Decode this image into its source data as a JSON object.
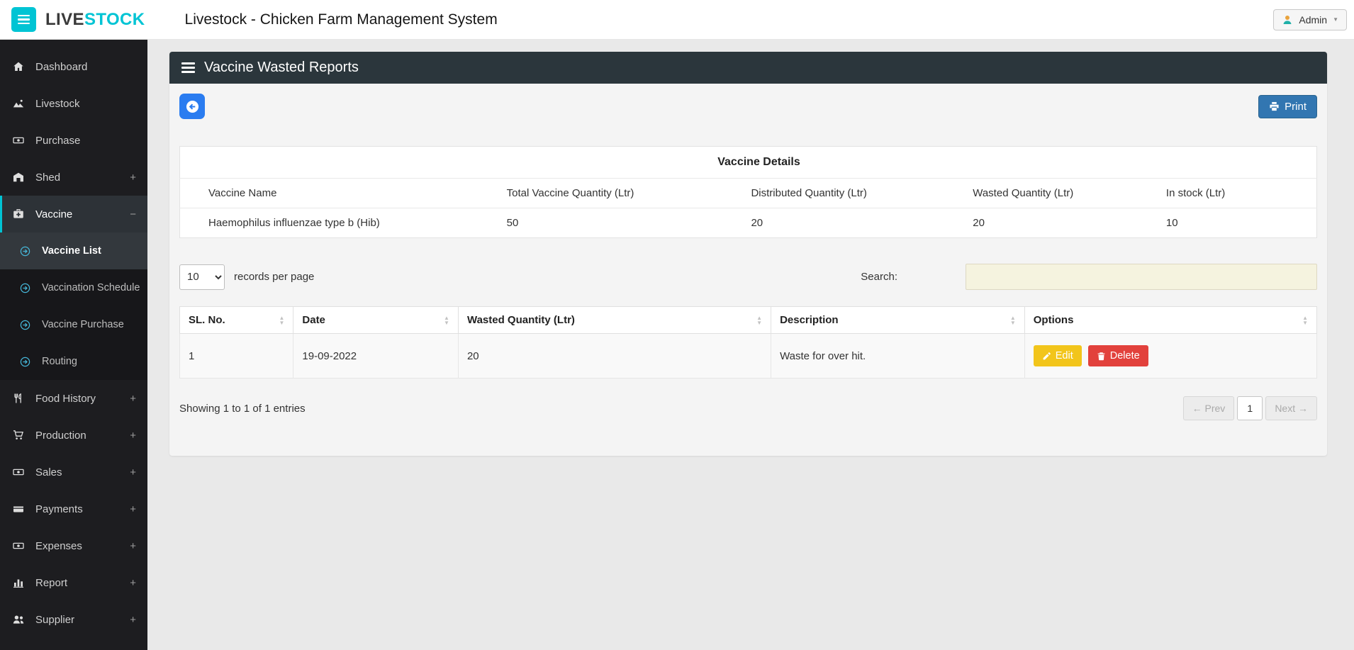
{
  "colors": {
    "accent_cyan": "#00c4d4",
    "sidebar_bg": "#1d1d20",
    "panel_header_bg": "#2b363c",
    "print_blue": "#3276b1",
    "back_blue": "#2a7cf0",
    "edit_yellow": "#f2c51b",
    "delete_red": "#e2413c",
    "search_bg": "#f5f3df"
  },
  "icons": {
    "sort_asc": "▲",
    "sort_desc": "▼",
    "caret_down": "▼"
  },
  "header": {
    "brand_live": "LIVE",
    "brand_stock": "STOCK",
    "title": "Livestock - Chicken Farm Management System",
    "admin_label": "Admin"
  },
  "sidebar": {
    "items": [
      {
        "label": "Dashboard",
        "suffix": ""
      },
      {
        "label": "Livestock",
        "suffix": ""
      },
      {
        "label": "Purchase",
        "suffix": ""
      },
      {
        "label": "Shed",
        "suffix": "+"
      },
      {
        "label": "Vaccine",
        "suffix": "−"
      },
      {
        "label": "Food History",
        "suffix": "+"
      },
      {
        "label": "Production",
        "suffix": "+"
      },
      {
        "label": "Sales",
        "suffix": "+"
      },
      {
        "label": "Payments",
        "suffix": "+"
      },
      {
        "label": "Expenses",
        "suffix": "+"
      },
      {
        "label": "Report",
        "suffix": "+"
      },
      {
        "label": "Supplier",
        "suffix": "+"
      }
    ],
    "vaccine_children": [
      {
        "label": "Vaccine List"
      },
      {
        "label": "Vaccination Schedule"
      },
      {
        "label": "Vaccine Purchase"
      },
      {
        "label": "Routing"
      }
    ]
  },
  "panel": {
    "title": "Vaccine Wasted Reports",
    "print_label": "Print"
  },
  "details_table": {
    "title": "Vaccine Details",
    "headers": [
      "Vaccine Name",
      "Total Vaccine Quantity (Ltr)",
      "Distributed Quantity (Ltr)",
      "Wasted Quantity (Ltr)",
      "In stock (Ltr)"
    ],
    "rows": [
      [
        "Haemophilus influenzae type b (Hib)",
        "50",
        "20",
        "20",
        "10"
      ]
    ]
  },
  "table_controls": {
    "page_size": "10",
    "records_label": "records per page",
    "search_label": "Search:",
    "search_value": ""
  },
  "report_table": {
    "headers": [
      "SL. No.",
      "Date",
      "Wasted Quantity (Ltr)",
      "Description",
      "Options"
    ],
    "rows": [
      {
        "sl": "1",
        "date": "19-09-2022",
        "wasted": "20",
        "description": "Waste for over hit.",
        "edit_label": "Edit",
        "delete_label": "Delete"
      }
    ]
  },
  "table_footer": {
    "showing": "Showing 1 to 1 of 1 entries",
    "prev": "← Prev",
    "page": "1",
    "next": "Next →"
  }
}
